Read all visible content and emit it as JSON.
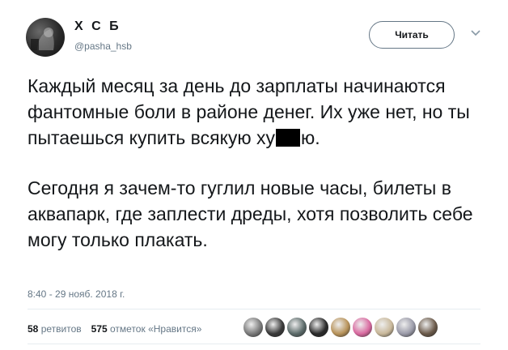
{
  "author": {
    "name": "Х С Б",
    "handle": "@pasha_hsb"
  },
  "follow_button": {
    "label": "Читать"
  },
  "tweet": {
    "paragraph1_before": "Каждый месяц за день до зарплаты начинаются фантомные боли в районе денег. Их уже нет, но ты пытаешься купить всякую ху",
    "paragraph1_after": "ю.",
    "paragraph2": "Сегодня я зачем-то гуглил новые часы, билеты в аквапарк, где заплести дреды, хотя позволить себе могу только плакать."
  },
  "timestamp": "8:40 - 29 нояб. 2018 г.",
  "stats": {
    "retweets_count": "58",
    "retweets_label": "ретвитов",
    "likes_count": "575",
    "likes_label": "отметок «Нравится»"
  },
  "likers": [
    {
      "icon": "avatar",
      "color": "#7a7a7a"
    },
    {
      "icon": "avatar",
      "color": "#3a3a3a"
    },
    {
      "icon": "avatar",
      "color": "#5c6b6a"
    },
    {
      "icon": "avatar",
      "color": "#2a2a2a"
    },
    {
      "icon": "avatar",
      "color": "#b8935a"
    },
    {
      "icon": "avatar",
      "color": "#d96aa0"
    },
    {
      "icon": "avatar",
      "color": "#c9b89a"
    },
    {
      "icon": "avatar",
      "color": "#9a9aa8"
    },
    {
      "icon": "avatar",
      "color": "#6b5a4a"
    }
  ]
}
